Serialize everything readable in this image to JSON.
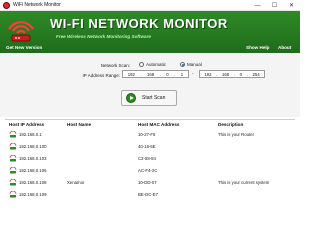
{
  "window": {
    "title": "WiFi Network Monitor",
    "controls": {
      "minimize": "—",
      "maximize": "☐",
      "close": "✕"
    }
  },
  "banner": {
    "brand": "WI-FI NETWORK MONITOR",
    "tagline": "Free Wireless Network Monitoring Software",
    "get_new_version": "Get New Version",
    "show_help": "Show Help",
    "about": "About",
    "logo_icon": "red-wifi-router-icon"
  },
  "scan": {
    "label": "Network Scan:",
    "options": [
      "Automatic",
      "Manual"
    ],
    "selected": "Manual",
    "ip_range_label": "IP Address Range:",
    "from": [
      "192",
      "168",
      "0",
      "1"
    ],
    "to": [
      "192",
      "168",
      "0",
      "254"
    ],
    "separator": "-",
    "button_label": "Start Scan"
  },
  "table": {
    "columns": [
      "Host IP Address",
      "Host Name",
      "Host MAC Address",
      "Description"
    ],
    "rows": [
      {
        "ip": "192.168.0.1",
        "name": "",
        "mac": "10-27-F5",
        "desc": "This is your Router"
      },
      {
        "ip": "192.168.0.100",
        "name": "",
        "mac": "40-16-5E",
        "desc": ""
      },
      {
        "ip": "192.168.0.103",
        "name": "",
        "mac": "C2-58-84",
        "desc": ""
      },
      {
        "ip": "192.168.0.106",
        "name": "",
        "mac": "AC-F4-2C",
        "desc": ""
      },
      {
        "ip": "192.168.0.108",
        "name": "Xenamor",
        "mac": "10-DD-07",
        "desc": "This is your current system"
      },
      {
        "ip": "192.168.0.109",
        "name": "",
        "mac": "BE-DC-E7",
        "desc": ""
      }
    ]
  },
  "colors": {
    "banner_green": "#2f8a26",
    "accent_red": "#d92b2b"
  }
}
